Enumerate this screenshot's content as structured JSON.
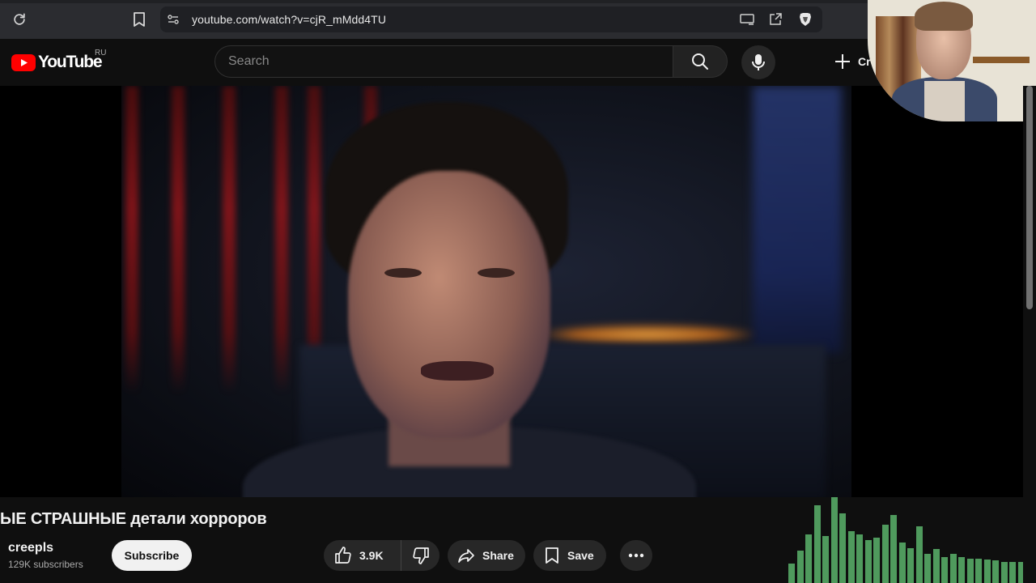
{
  "browser": {
    "url": "youtube.com/watch?v=cjR_mMdd4TU",
    "icons": [
      "reload-icon",
      "bookmark-icon",
      "site-settings-icon",
      "cast-icon",
      "share-icon",
      "brave-shield-icon"
    ]
  },
  "masthead": {
    "logo_text": "YouTube",
    "region": "RU",
    "search_placeholder": "Search",
    "create_label": "Cr"
  },
  "video": {
    "title": "ЫЕ СТРАШНЫЕ детали хорроров",
    "channel": "creepls",
    "subscribers": "129K subscribers",
    "subscribe_label": "Subscribe",
    "likes": "3.9K",
    "share_label": "Share",
    "save_label": "Save"
  },
  "audio_meter": {
    "levels": [
      0.2,
      0.33,
      0.5,
      0.8,
      0.48,
      0.88,
      0.72,
      0.53,
      0.5,
      0.44,
      0.47,
      0.6,
      0.7,
      0.42,
      0.36,
      0.58,
      0.3,
      0.35,
      0.27,
      0.3,
      0.27,
      0.25,
      0.25,
      0.24,
      0.23,
      0.22,
      0.22,
      0.22
    ]
  },
  "colors": {
    "background": "#0f0f0f",
    "brand_red": "#ff0000",
    "meter_green": "#4f9a5d",
    "button_bg": "#272727"
  }
}
